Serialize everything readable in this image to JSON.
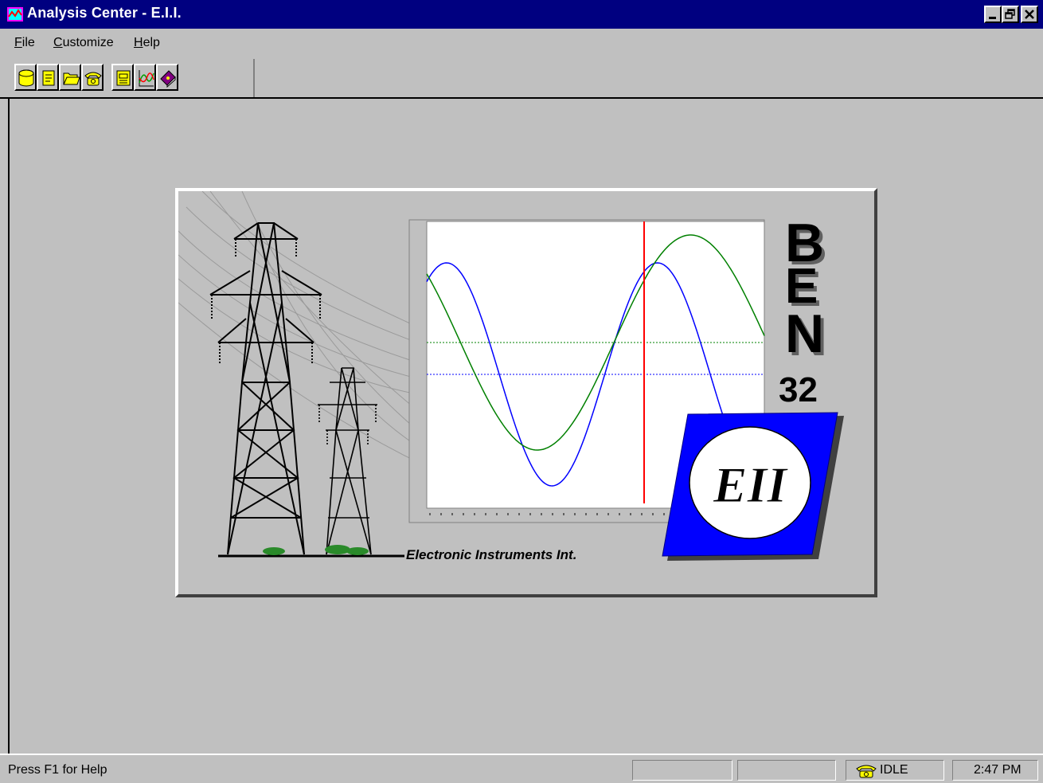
{
  "window": {
    "title": "Analysis Center - E.I.I."
  },
  "menu": {
    "items": [
      {
        "label": "File"
      },
      {
        "label": "Customize"
      },
      {
        "label": "Help"
      }
    ]
  },
  "toolbar": {
    "buttons": [
      {
        "icon": "database-icon"
      },
      {
        "icon": "new-document-icon"
      },
      {
        "icon": "open-folder-icon"
      },
      {
        "icon": "telephone-icon"
      },
      {
        "icon": "window-icon"
      },
      {
        "icon": "waveform-icon"
      },
      {
        "icon": "book-icon"
      }
    ]
  },
  "splash": {
    "product_letters": [
      "B",
      "E",
      "N"
    ],
    "product_version": "32",
    "logo_text": "EII",
    "company_name": "Electronic Instruments Int."
  },
  "colors": {
    "title_bar": "#000080",
    "face": "#c0c0c0",
    "trace_blue": "#0000ff",
    "trace_green": "#008000",
    "cursor_red": "#ff0000",
    "logo_blue": "#0000ff"
  },
  "statusbar": {
    "help_text": "Press F1 for Help",
    "panel1": "",
    "panel2": "",
    "modem_status": "IDLE",
    "clock": "2:47 PM"
  }
}
